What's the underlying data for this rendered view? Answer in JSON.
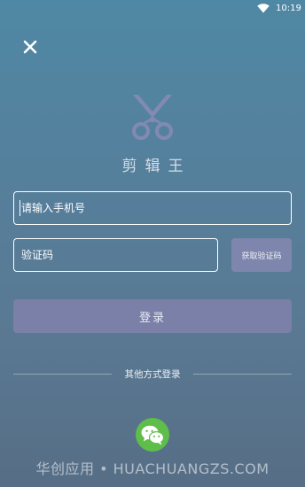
{
  "status_bar": {
    "time": "10:19",
    "wifi_icon": "wifi-icon"
  },
  "close_icon": "close-icon",
  "app": {
    "logo_icon": "scissors-icon",
    "name": "剪辑王"
  },
  "login_form": {
    "phone_placeholder": "请输入手机号",
    "code_placeholder": "验证码",
    "get_code_label": "获取验证码",
    "login_label": "登录"
  },
  "other_login": {
    "label": "其他方式登录",
    "wechat_icon": "wechat-icon"
  },
  "colors": {
    "wechat_green": "#5fbd4a",
    "button_purple": "#7a80a8"
  },
  "watermark": "华创应用 • HUACHUANGZS.COM"
}
